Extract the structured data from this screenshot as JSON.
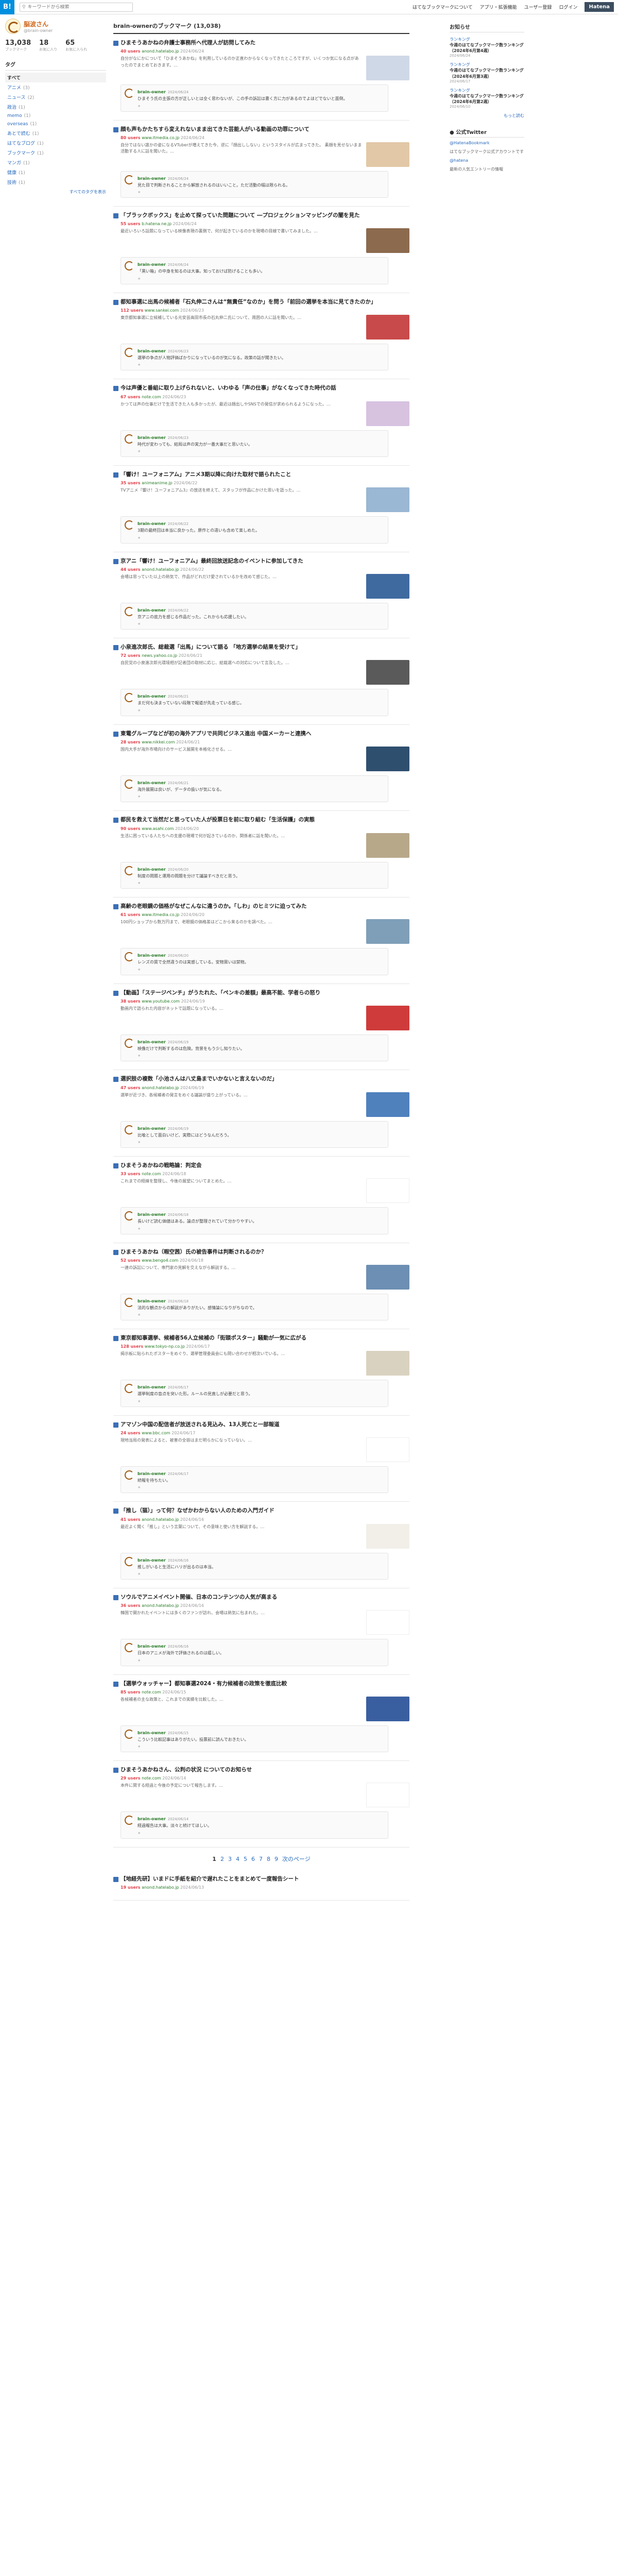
{
  "header": {
    "logo": "B!",
    "search_placeholder": "キーワードから検索",
    "nav": [
      "はてなブックマークについて",
      "アプリ・拡張機能",
      "ユーザー登録",
      "ログイン"
    ],
    "hatena": "Hatena"
  },
  "profile": {
    "name": "脳波さん",
    "id": "@brain-owner",
    "stats": [
      {
        "n": "13,038",
        "l": "ブックマーク"
      },
      {
        "n": "18",
        "l": "お気に入り"
      },
      {
        "n": "65",
        "l": "お気に入られ"
      }
    ]
  },
  "tags": {
    "heading": "タグ",
    "items": [
      {
        "label": "すべて",
        "count": ""
      },
      {
        "label": "アニメ",
        "count": "(3)"
      },
      {
        "label": "ニュース",
        "count": "(2)"
      },
      {
        "label": "政治",
        "count": "(1)"
      },
      {
        "label": "memo",
        "count": "(1)"
      },
      {
        "label": "overseas",
        "count": "(1)"
      },
      {
        "label": "あとで読む",
        "count": "(1)"
      },
      {
        "label": "はてなブログ",
        "count": "(1)"
      },
      {
        "label": "ブックマーク",
        "count": "(1)"
      },
      {
        "label": "マンガ",
        "count": "(1)"
      },
      {
        "label": "健康",
        "count": "(1)"
      },
      {
        "label": "技術",
        "count": "(1)"
      }
    ],
    "more": "すべてのタグを表示"
  },
  "page_title": "brain-ownerのブックマーク (13,038)",
  "entries": [
    {
      "title": "ひまそうあかねの弁護士事務所へ代理人が訪問してみた",
      "users": "40 users",
      "domain": "anond.hatelabo.jp",
      "date": "2024/06/24",
      "summary": "自分がなにかについて「ひまそうあかね」を利用しているのか正直わからなくなってきたところですが、いくつか気になる点があったのでまとめておきます。…",
      "thumb": "#cfd8e6",
      "cmt_user": "brain-owner",
      "cmt_date": "2024/06/24",
      "cmt": "ひまそう氏の主張の方が正しいとは全く思わないが、この手の訴訟は書く方に力があるのでよほどでないと面倒。"
    },
    {
      "title": "顔も声もかたちすら変えれないまま出てきた芸能人がいる動画の功罪について",
      "users": "80 users",
      "domain": "www.itmedia.co.jp",
      "date": "2024/06/24",
      "summary": "自分ではない誰かの姿になるVTuberが増えてきた今、逆に「顔出ししない」というスタイルが広まってきた。 素顔を見せないまま活動する人に話を聞いた。…",
      "thumb": "#e2c8a6",
      "cmt_user": "brain-owner",
      "cmt_date": "2024/06/24",
      "cmt": "見た目で判断されることから解放されるのはいいこと。ただ活動の幅は限られる。"
    },
    {
      "title": "「ブラックボックス」を止めて探っていた問題について ―プロジェクションマッピングの闇を見た",
      "users": "55 users",
      "domain": "b.hatena.ne.jp",
      "date": "2024/06/24",
      "summary": "最近いろいろ話題になっている映像表現の裏側で、何が起きているのかを現場の目線で書いてみました。…",
      "thumb": "#8c6a4e",
      "cmt_user": "brain-owner",
      "cmt_date": "2024/06/24",
      "cmt": "「黒い箱」の中身を知るのは大事。知っておけば防げることも多い。"
    },
    {
      "title": "都知事選に出馬の候補者「石丸伸二さんは“無責任”なのか」を問う「前回の選挙を本当に見てきたのか」",
      "users": "112 users",
      "domain": "www.sankei.com",
      "date": "2024/06/23",
      "summary": "東京都知事選に立候補している元安芸高田市長の石丸伸二氏について、周囲の人に話を聞いた。…",
      "thumb": "#c94a4a",
      "cmt_user": "brain-owner",
      "cmt_date": "2024/06/23",
      "cmt": "選挙の争点が人物評価ばかりになっているのが気になる。政策の話が聞きたい。"
    },
    {
      "title": "今は声優と番組に取り上げられないと、いわゆる「声の仕事」がなくなってきた時代の話",
      "users": "67 users",
      "domain": "note.com",
      "date": "2024/06/23",
      "summary": "かつては声の仕事だけで生活できた人も多かったが、最近は顔出しやSNSでの発信が求められるようになった。…",
      "thumb": "#d7c2e0",
      "cmt_user": "brain-owner",
      "cmt_date": "2024/06/23",
      "cmt": "時代が変わっても、結局は声の実力が一番大事だと思いたい。"
    },
    {
      "title": "「響け！ユーフォニアム」アニメ3期以降に向けた取材で語られたこと",
      "users": "35 users",
      "domain": "animeanime.jp",
      "date": "2024/06/22",
      "summary": "TVアニメ『響け！ユーフォニアム3』の放送を終えて、スタッフが作品にかけた思いを語った。…",
      "thumb": "#9ab7d4",
      "cmt_user": "brain-owner",
      "cmt_date": "2024/06/22",
      "cmt": "3期の最終回は本当に良かった。原作との違いも含めて楽しめた。"
    },
    {
      "title": "京アニ「響け！ユーフォニアム」最終回放送記念のイベントに参加してきた",
      "users": "44 users",
      "domain": "anond.hatelabo.jp",
      "date": "2024/06/22",
      "summary": "会場は思っていた以上の熱気で、作品がどれだけ愛されているかを改めて感じた。…",
      "thumb": "#3f6aa0",
      "cmt_user": "brain-owner",
      "cmt_date": "2024/06/22",
      "cmt": "京アニの底力を感じる作品だった。これからも応援したい。"
    },
    {
      "title": "小泉進次郎氏、総裁選「出馬」について語る 「地方選挙の結果を受けて」",
      "users": "72 users",
      "domain": "news.yahoo.co.jp",
      "date": "2024/06/21",
      "summary": "自民党の小泉進次郎元環境相が記者団の取材に応じ、総裁選への対応について言及した。…",
      "thumb": "#5a5a5a",
      "cmt_user": "brain-owner",
      "cmt_date": "2024/06/21",
      "cmt": "まだ何も決まっていない段階で報道が先走っている感じ。"
    },
    {
      "title": "東電グループなどが初の海外アプリで共同ビジネス進出 中国メーカーと連携へ",
      "users": "28 users",
      "domain": "www.nikkei.com",
      "date": "2024/06/21",
      "summary": "国内大手が海外市場向けのサービス展開を本格化させる。…",
      "thumb": "#2f4f6f",
      "cmt_user": "brain-owner",
      "cmt_date": "2024/06/21",
      "cmt": "海外展開は良いが、データの扱いが気になる。"
    },
    {
      "title": "都民を救えて当然だと思っていた人が投票日を前に取り組む「生活保護」の実態",
      "users": "90 users",
      "domain": "www.asahi.com",
      "date": "2024/06/20",
      "summary": "生活に困っている人たちへの支援の現場で何が起きているのか、関係者に話を聞いた。…",
      "thumb": "#b8a88a",
      "cmt_user": "brain-owner",
      "cmt_date": "2024/06/20",
      "cmt": "制度の問題と運用の問題を分けて議論すべきだと思う。"
    },
    {
      "title": "高齢の老眼鏡の価格がなぜこんなに違うのか。「しわ」のヒミツに迫ってみた",
      "users": "61 users",
      "domain": "www.itmedia.co.jp",
      "date": "2024/06/20",
      "summary": "100円ショップから数万円まで、老眼鏡の価格差はどこから来るのかを調べた。…",
      "thumb": "#7f9fb8",
      "cmt_user": "brain-owner",
      "cmt_date": "2024/06/20",
      "cmt": "レンズの質で全然違うのは実感している。安物買いは禁物。"
    },
    {
      "title": "【動画】「ステージベンチ」がうたれた、「ペンキの差額」最高不能、学者らの怒り",
      "users": "38 users",
      "domain": "www.youtube.com",
      "date": "2024/06/19",
      "summary": "動画内で語られた内容がネットで話題になっている。…",
      "thumb": "#cf3b3b",
      "cmt_user": "brain-owner",
      "cmt_date": "2024/06/19",
      "cmt": "映像だけで判断するのは危険。背景をもう少し知りたい。"
    },
    {
      "title": "選択肢の複数「小池さんは八丈島までいかないと言えないのだ」",
      "users": "47 users",
      "domain": "anond.hatelabo.jp",
      "date": "2024/06/19",
      "summary": "選挙が近づき、各候補者の発言をめぐる議論が盛り上がっている。…",
      "thumb": "#4f81bd",
      "cmt_user": "brain-owner",
      "cmt_date": "2024/06/19",
      "cmt": "比喩として面白いけど、実際にはどうなんだろう。"
    },
    {
      "title": "ひまそうあかねの戦略論：判定会",
      "users": "33 users",
      "domain": "note.com",
      "date": "2024/06/18",
      "summary": "これまでの経緯を整理し、今後の展望についてまとめた。…",
      "thumb": "#ffffff",
      "cmt_user": "brain-owner",
      "cmt_date": "2024/06/18",
      "cmt": "長いけど読む価値はある。論点が整理されていて分かりやすい。"
    },
    {
      "title": "ひまそうあかね（暇空茜）氏の被告事件は判断されるのか？",
      "users": "52 users",
      "domain": "www.bengo4.com",
      "date": "2024/06/18",
      "summary": "一連の訴訟について、専門家の見解を交えながら解説する。…",
      "thumb": "#6d8fb3",
      "cmt_user": "brain-owner",
      "cmt_date": "2024/06/18",
      "cmt": "法的な観点からの解説がありがたい。感情論になりがちなので。"
    },
    {
      "title": "東京都知事選挙、候補者56人立候補の「街頭ポスター」騒動が一気に広がる",
      "users": "128 users",
      "domain": "www.tokyo-np.co.jp",
      "date": "2024/06/17",
      "summary": "掲示板に貼られたポスターをめぐり、選挙管理委員会にも問い合わせが相次いでいる。…",
      "thumb": "#d9d2c0",
      "cmt_user": "brain-owner",
      "cmt_date": "2024/06/17",
      "cmt": "選挙制度の盲点を突いた形。ルールの見直しが必要だと思う。"
    },
    {
      "title": "アマゾン中国の配信者が放送される見込み、13人死亡と一部報道",
      "users": "24 users",
      "domain": "www.bbc.com",
      "date": "2024/06/17",
      "summary": "現地当局の発表によると、被害の全容はまだ明らかになっていない。…",
      "thumb": "#ffffff",
      "cmt_user": "brain-owner",
      "cmt_date": "2024/06/17",
      "cmt": "続報を待ちたい。"
    },
    {
      "title": "「推し（猫）」って何？なぜかわからない人のための入門ガイド",
      "users": "41 users",
      "domain": "anond.hatelabo.jp",
      "date": "2024/06/16",
      "summary": "最近よく聞く「推し」という言葉について、その意味と使い方を解説する。…",
      "thumb": "#f2efe8",
      "cmt_user": "brain-owner",
      "cmt_date": "2024/06/16",
      "cmt": "推しがいると生活にハリが出るのは本当。"
    },
    {
      "title": "ソウルでアニメイベント開催、日本のコンテンツの人気が高まる",
      "users": "36 users",
      "domain": "anond.hatelabo.jp",
      "date": "2024/06/16",
      "summary": "韓国で開かれたイベントには多くのファンが訪れ、会場は熱気に包まれた。…",
      "thumb": "#ffffff",
      "cmt_user": "brain-owner",
      "cmt_date": "2024/06/16",
      "cmt": "日本のアニメが海外で評価されるのは嬉しい。"
    },
    {
      "title": "【選挙ウォッチャー】都知事選2024・有力候補者の政策を徹底比較",
      "users": "85 users",
      "domain": "note.com",
      "date": "2024/06/15",
      "summary": "各候補者の主な政策と、これまでの実績を比較した。…",
      "thumb": "#3a5fa0",
      "cmt_user": "brain-owner",
      "cmt_date": "2024/06/15",
      "cmt": "こういう比較記事はありがたい。投票前に読んでおきたい。"
    },
    {
      "title": "ひまそうあかねさん、公判の状況 についてのお知らせ",
      "users": "29 users",
      "domain": "note.com",
      "date": "2024/06/14",
      "summary": "本件に関する経過と今後の予定について報告します。…",
      "thumb": "#ffffff",
      "cmt_user": "brain-owner",
      "cmt_date": "2024/06/14",
      "cmt": "経過報告は大事。淡々と続けてほしい。"
    }
  ],
  "pager": {
    "pages": [
      "1",
      "2",
      "3",
      "4",
      "5",
      "6",
      "7",
      "8",
      "9"
    ],
    "next": "次のページ"
  },
  "last_entry": {
    "title": "【地経先研】いまドに手紙を紹介で遅れたことをまとめて一度報告シート",
    "users": "19 users",
    "domain": "anond.hatelabo.jp",
    "date": "2024/06/13"
  },
  "right": {
    "notice_h": "お知らせ",
    "rankings": [
      {
        "t": "ランキング",
        "s": "今週のはてなブックマーク数ランキング（2024年6月第4週）",
        "d": "2024/06/24"
      },
      {
        "t": "ランキング",
        "s": "今週のはてなブックマーク数ランキング（2024年6月第3週）",
        "d": "2024/06/17"
      },
      {
        "t": "ランキング",
        "s": "今週のはてなブックマーク数ランキング（2024年6月第2週）",
        "d": "2024/06/10"
      }
    ],
    "more": "もっと読む",
    "tw_h": "公式Twitter",
    "tw": [
      "@HatenaBookmark",
      "はてなブックマーク公式アカウントです",
      "@hatena",
      "最新の人気エントリーの情報"
    ]
  },
  "colors": {
    "accent": "#008fde",
    "users": "#e0414b",
    "domain": "#2a7d2a"
  }
}
